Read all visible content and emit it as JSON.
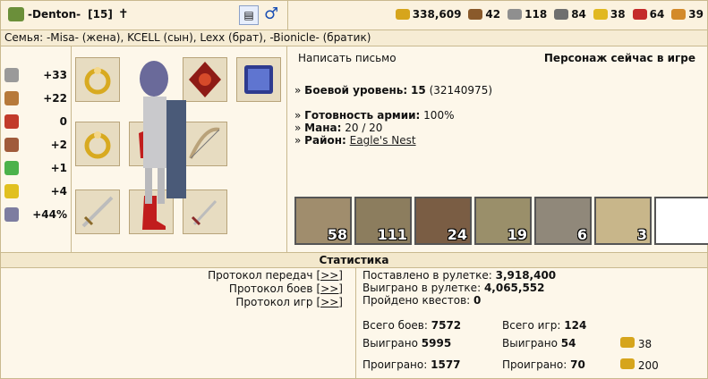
{
  "header": {
    "nickname": "-Denton-",
    "level": "[15]",
    "cross": "✝",
    "gender_symbol": "♂",
    "resources": [
      {
        "icon": "gold-icon",
        "value": "338,609",
        "color": "#d6a51c"
      },
      {
        "icon": "wood-icon",
        "value": "42",
        "color": "#8a5a2b"
      },
      {
        "icon": "ore-icon",
        "value": "118",
        "color": "#8f8f8f"
      },
      {
        "icon": "mercury-icon",
        "value": "84",
        "color": "#6f6f6f"
      },
      {
        "icon": "sulfur-icon",
        "value": "38",
        "color": "#e1b820"
      },
      {
        "icon": "crystal-icon",
        "value": "64",
        "color": "#c42a2a"
      },
      {
        "icon": "gems-icon",
        "value": "39",
        "color": "#d38a2a"
      }
    ]
  },
  "family": "Семья: -Misa- (жена), KCELL (сын), Lexx (брат), -Bionicle- (братик)",
  "stats": [
    {
      "icon": "attack-icon",
      "value": "+33"
    },
    {
      "icon": "defense-icon",
      "value": "+22"
    },
    {
      "icon": "spellpower-icon",
      "value": "0"
    },
    {
      "icon": "knowledge-icon",
      "value": "+2"
    },
    {
      "icon": "luck-icon",
      "value": "+1"
    },
    {
      "icon": "morale-icon",
      "value": "+4"
    },
    {
      "icon": "initiative-icon",
      "value": "+44%"
    }
  ],
  "profile": {
    "write_letter": "Написать письмо",
    "online_status": "Персонаж сейчас в игре",
    "combat_level_label": "Боевой уровень:",
    "combat_level": "15",
    "experience": "(32140975)",
    "army_ready_label": "Готовность армии:",
    "army_ready": "100%",
    "mana_label": "Мана:",
    "mana": "20 / 20",
    "district_label": "Район:",
    "district": "Eagle's Nest",
    "bullet": "»"
  },
  "army": [
    {
      "count": "58",
      "color": "#a08d6d"
    },
    {
      "count": "111",
      "color": "#8c7d5e"
    },
    {
      "count": "24",
      "color": "#7a5d44"
    },
    {
      "count": "19",
      "color": "#9a8f6a"
    },
    {
      "count": "6",
      "color": "#90887a"
    },
    {
      "count": "3",
      "color": "#c8b68a"
    },
    {
      "count": "",
      "color": "#ffffff"
    }
  ],
  "statistics": {
    "heading": "Статистика",
    "protocols": [
      {
        "label": "Протокол передач",
        "link": "[>>]"
      },
      {
        "label": "Протокол боев",
        "link": "[>>]"
      },
      {
        "label": "Протокол игр",
        "link": "[>>]"
      }
    ],
    "roulette_bet_label": "Поставлено в рулетке:",
    "roulette_bet": "3,918,400",
    "roulette_won_label": "Выиграно в рулетке:",
    "roulette_won": "4,065,552",
    "quests_label": "Пройдено квестов:",
    "quests": "0",
    "battles_total_label": "Всего боев:",
    "battles_total": "7572",
    "battles_won_label": "Выиграно",
    "battles_won": "5995",
    "battles_lost_label": "Проиграно:",
    "battles_lost": "1577",
    "games_total_label": "Всего игр:",
    "games_total": "124",
    "games_won_label": "Выиграно",
    "games_won": "54",
    "games_lost_label": "Проиграно:",
    "games_lost": "70",
    "gold_won": "38",
    "gold_lost": "200"
  }
}
